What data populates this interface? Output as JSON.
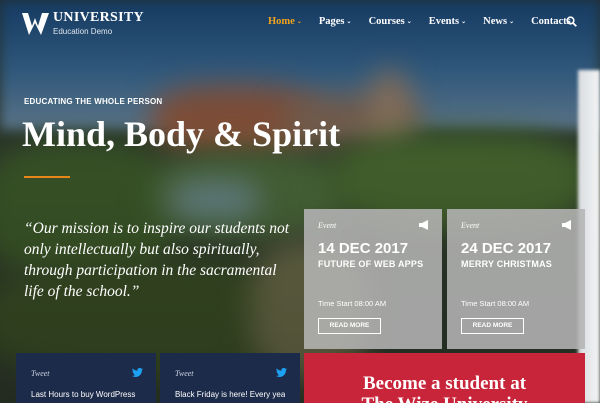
{
  "header": {
    "logo_name": "UNIVERSITY",
    "logo_sub": "Education Demo",
    "nav": [
      {
        "label": "Home",
        "active": true,
        "dropdown": true
      },
      {
        "label": "Pages",
        "active": false,
        "dropdown": true
      },
      {
        "label": "Courses",
        "active": false,
        "dropdown": true
      },
      {
        "label": "Events",
        "active": false,
        "dropdown": true
      },
      {
        "label": "News",
        "active": false,
        "dropdown": true
      },
      {
        "label": "Contacts",
        "active": false,
        "dropdown": false
      }
    ],
    "search_icon": "search-icon"
  },
  "hero": {
    "kicker": "EDUCATING THE WHOLE PERSON",
    "title": "Mind, Body & Spirit",
    "quote": "“Our mission is to inspire our students not only intellectually but also spiritually, through participation in the sacramental life of the school.”"
  },
  "events": [
    {
      "type": "Event",
      "date": "14 DEC 2017",
      "title": "FUTURE OF WEB APPS",
      "time": "Time Start 08:00 AM",
      "button": "READ MORE"
    },
    {
      "type": "Event",
      "date": "24 DEC 2017",
      "title": "MERRY CHRISTMAS",
      "time": "Time Start 08:00 AM",
      "button": "READ MORE"
    }
  ],
  "tweets": [
    {
      "label": "Tweet",
      "text": "Last Hours to buy WordPress"
    },
    {
      "label": "Tweet",
      "text": "Black Friday is here! Every year we"
    }
  ],
  "cta": {
    "line1": "Become a student at",
    "line2": "The Wize University"
  },
  "colors": {
    "accent": "#f0a21a",
    "rule": "#e8861a",
    "tweet_bg": "#1c2b4a",
    "cta_bg": "#c8253a",
    "event_bg": "#b4b4b4"
  }
}
